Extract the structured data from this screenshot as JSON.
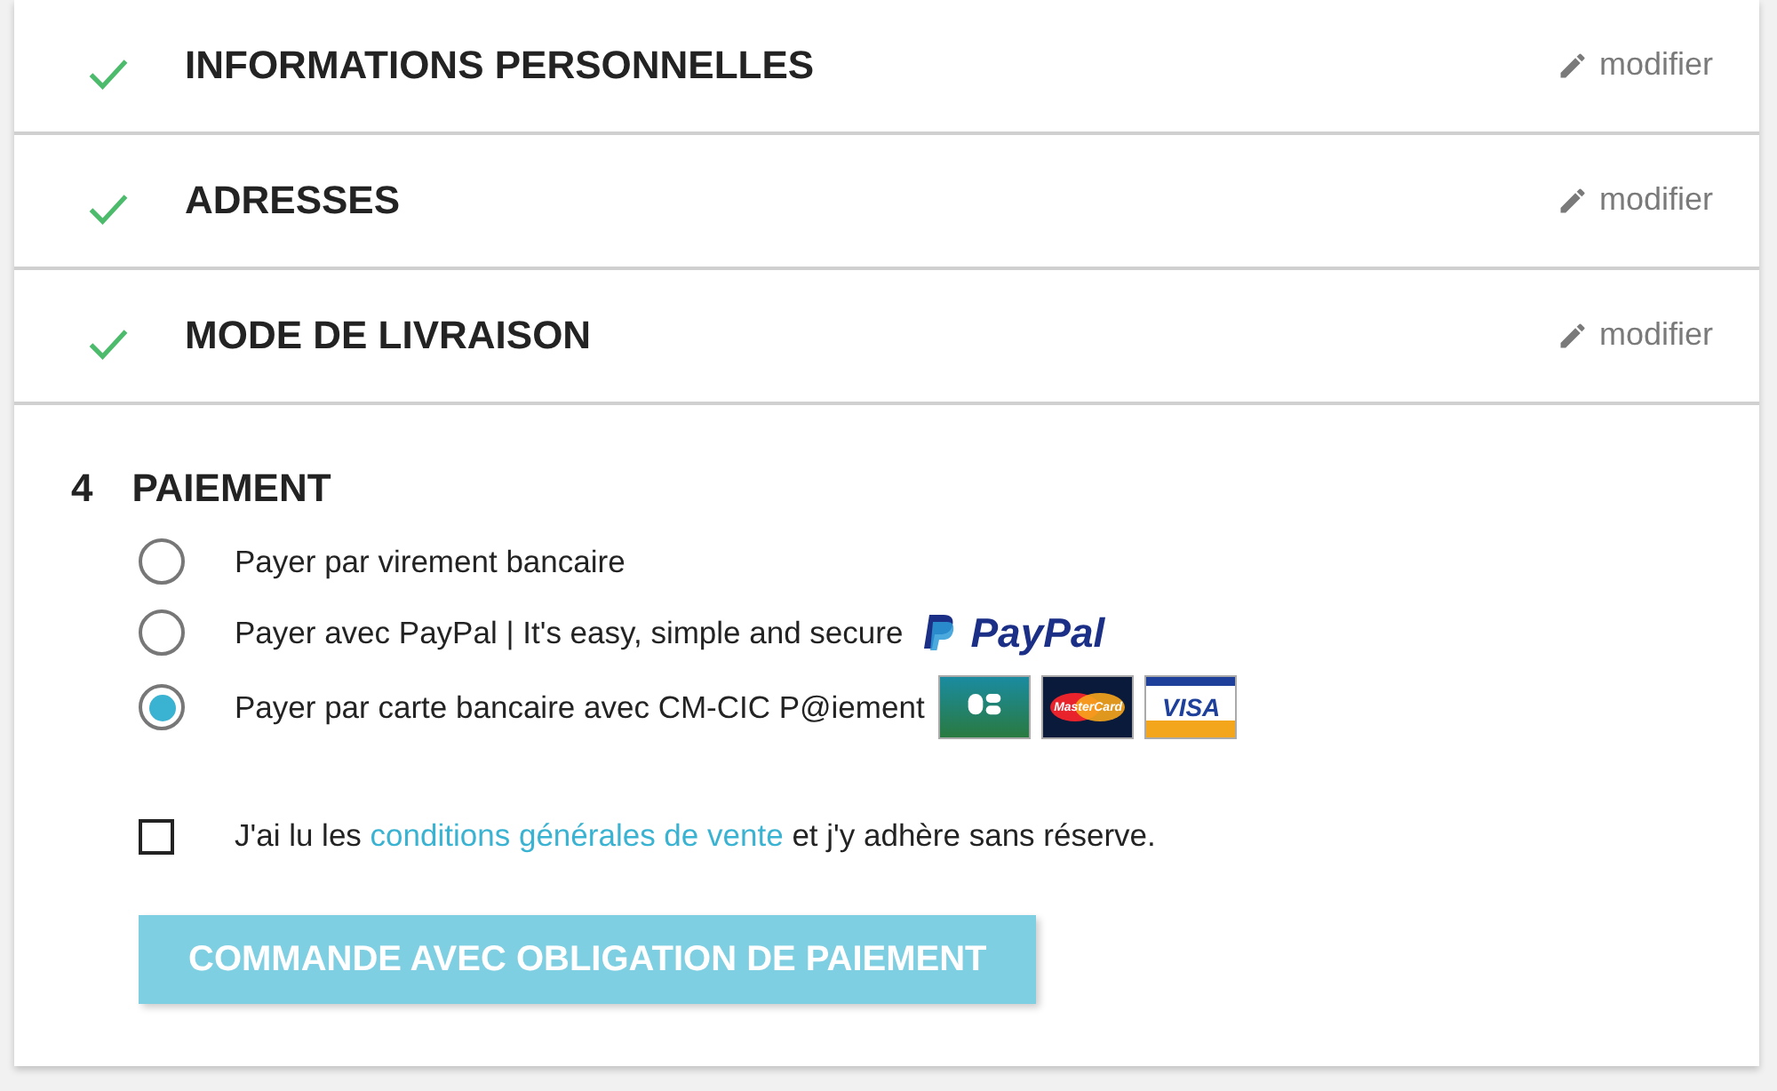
{
  "steps": [
    {
      "title": "INFORMATIONS PERSONNELLES",
      "done": true,
      "action": "modifier"
    },
    {
      "title": "ADRESSES",
      "done": true,
      "action": "modifier"
    },
    {
      "title": "MODE DE LIVRAISON",
      "done": true,
      "action": "modifier"
    }
  ],
  "current_step": {
    "number": "4",
    "title": "PAIEMENT"
  },
  "payment_options": [
    {
      "label": "Payer par virement bancaire",
      "selected": false
    },
    {
      "label": "Payer avec PayPal | It's easy, simple and secure",
      "selected": false,
      "logos": [
        {
          "kind": "paypal",
          "text": "PayPal"
        }
      ]
    },
    {
      "label": "Payer par carte bancaire avec CM-CIC P@iement",
      "selected": true,
      "logos": [
        {
          "kind": "cb"
        },
        {
          "kind": "mastercard",
          "text": "MasterCard"
        },
        {
          "kind": "visa",
          "text": "VISA"
        }
      ]
    }
  ],
  "terms": {
    "checked": false,
    "before": "J'ai lu les ",
    "link": "conditions générales de vente",
    "after": " et j'y adhère sans réserve."
  },
  "submit_button": "COMMANDE AVEC OBLIGATION DE PAIEMENT"
}
